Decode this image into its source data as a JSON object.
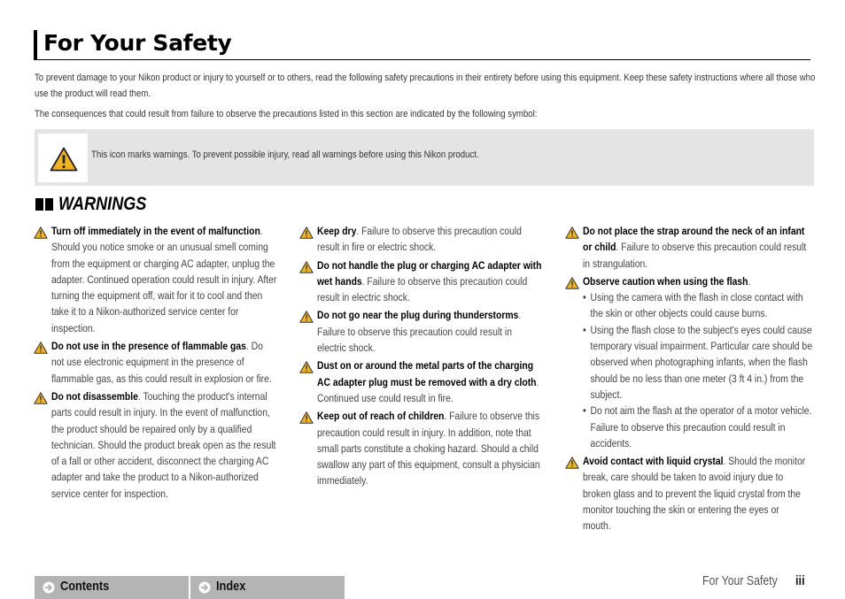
{
  "page": {
    "title": "For Your Safety",
    "intro_paragraph_1": "To prevent damage to your Nikon product or injury to yourself or to others, read the following safety precautions in their entirety before using this equipment. Keep these safety instructions where all those who use the product will read them.",
    "intro_paragraph_2": "The consequences that could result from failure to observe the precautions listed in this section are indicated by the following symbol:",
    "symbol_box": {
      "icon": "warning-triangle-icon",
      "text": "This icon marks warnings. To prevent possible injury, read all warnings before using this Nikon product."
    },
    "section": {
      "title": "WARNINGS",
      "icon": "double-square-icon"
    }
  },
  "warnings": {
    "col1": [
      {
        "bold": "Turn off immediately in the event of malfunction",
        "text": ". Should you notice smoke or an unusual smell coming from the equipment or charging AC adapter, unplug the adapter. Continued operation could result in injury. After turning the equipment off, wait for it to cool and then take it to a Nikon-authorized service center for inspection."
      },
      {
        "bold": "Do not use in the presence of flammable gas",
        "text": ". Do not use electronic equipment in the presence of flammable gas, as this could result in explosion or fire."
      },
      {
        "bold": "Do not disassemble",
        "text": ". Touching the product's internal parts could result in injury. In the event of malfunction, the product should be repaired only by a qualified technician. Should the product break open as the result of a fall or other accident, disconnect the charging AC adapter and take the product to a Nikon-authorized service center for inspection."
      }
    ],
    "col2": [
      {
        "bold": "Keep dry",
        "text": ". Failure to observe this precaution could result in fire or electric shock."
      },
      {
        "bold": "Do not handle the plug or charging AC adapter with wet hands",
        "text": ". Failure to observe this precaution could result in electric shock."
      },
      {
        "bold": "Do not go near the plug during thunderstorms",
        "text": ". Failure to observe this precaution could result in electric shock."
      },
      {
        "bold": "Dust on or around the metal parts of the charging AC adapter plug must be removed with a dry cloth",
        "text": ". Continued use could result in fire."
      },
      {
        "bold": "Keep out of reach of children",
        "text": ". Failure to observe this precaution could result in injury. In addition, note that small parts constitute a choking hazard. Should a child swallow any part of this equipment, consult a physician immediately."
      }
    ],
    "col3": [
      {
        "bold": "Do not place the strap around the neck of an infant or child",
        "text": ". Failure to observe this precaution could result in strangulation."
      },
      {
        "bold": "Observe caution when using the flash",
        "text": ".",
        "bullets": [
          "Using the camera with the flash in close contact with the skin or other objects could cause burns.",
          "Using the flash close to the subject's eyes could cause temporary visual impairment. Particular care should be observed when photographing infants, when the flash should be no less than one meter (3 ft 4 in.) from the subject.",
          "Do not aim the flash at the operator of a motor vehicle. Failure to observe this precaution could result in accidents."
        ]
      },
      {
        "bold": "Avoid contact with liquid crystal",
        "text": ". Should the monitor break, care should be taken to avoid injury due to broken glass and to prevent the liquid crystal from the monitor touching the skin or entering the eyes or mouth."
      }
    ]
  },
  "footer": {
    "nav": [
      {
        "label": "Contents",
        "icon": "arrow-right-circle-icon"
      },
      {
        "label": "Index",
        "icon": "arrow-right-circle-icon"
      }
    ],
    "section_name": "For Your Safety",
    "page_number": "iii"
  },
  "colors": {
    "warning_yellow": "#f0b323",
    "symbol_box_bg": "#e4e4e4",
    "nav_bg": "#b4b4b4"
  }
}
